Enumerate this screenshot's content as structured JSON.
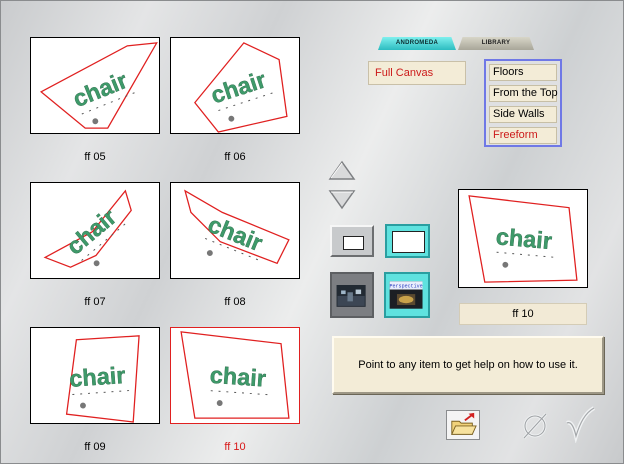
{
  "tabs": [
    {
      "label": "ANDROMEDA",
      "active": true
    },
    {
      "label": "LIBRARY",
      "active": false
    }
  ],
  "canvas_option": "Full Canvas",
  "submenu": {
    "items": [
      {
        "label": "Floors"
      },
      {
        "label": "From the Top"
      },
      {
        "label": "Side Walls"
      },
      {
        "label": "Freeform",
        "selected": true
      }
    ]
  },
  "thumbnails": [
    {
      "label": "ff 05"
    },
    {
      "label": "ff 06"
    },
    {
      "label": "ff 07"
    },
    {
      "label": "ff 08"
    },
    {
      "label": "ff 09"
    },
    {
      "label": "ff 10",
      "selected": true
    }
  ],
  "thumbnail_text": "chair",
  "perspective_button_text": "Perspective",
  "preview": {
    "label": "ff 10"
  },
  "help_text": "Point to any item to get help on how to use it.",
  "colors": {
    "accent": "#cc1a1a",
    "chair_green": "#3e9a6a",
    "tab_active": "#4fd8d6",
    "panel": "#f3ecd7",
    "menu_border": "#6f78e6"
  },
  "icons": [
    "arrow-up-icon",
    "arrow-down-icon",
    "rect-outline-icon",
    "rect-filled-icon",
    "night-photo-icon",
    "perspective-photo-icon",
    "folder-open-icon",
    "null-icon",
    "check-icon"
  ]
}
